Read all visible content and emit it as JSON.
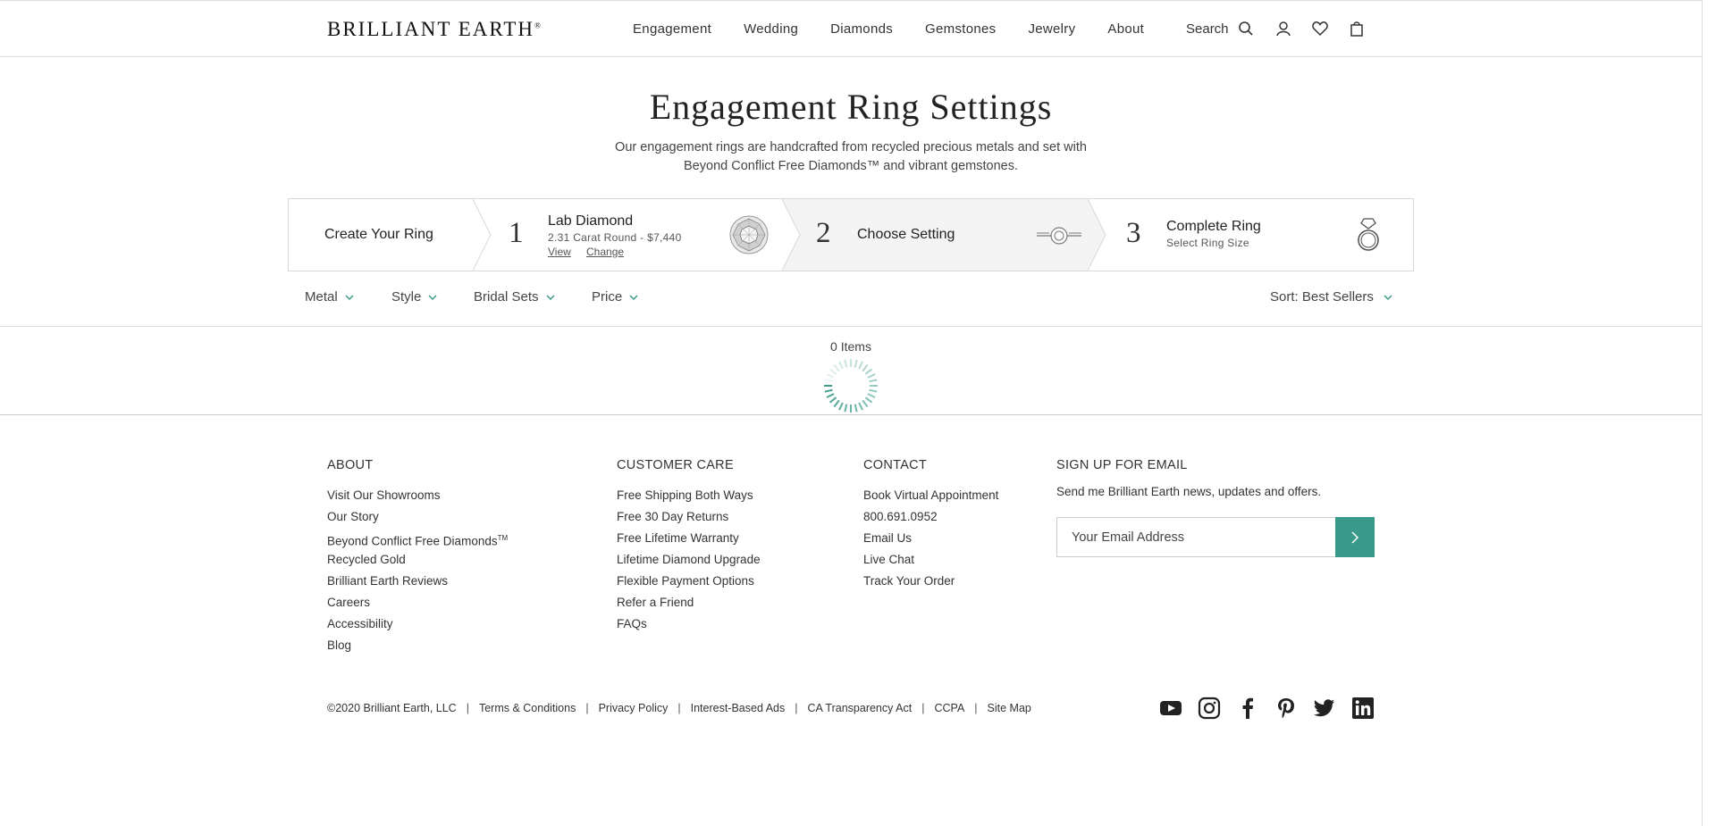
{
  "header": {
    "logo": "BRILLIANT EARTH",
    "logo_mark": "®",
    "nav": [
      "Engagement",
      "Wedding",
      "Diamonds",
      "Gemstones",
      "Jewelry",
      "About"
    ],
    "search_label": "Search"
  },
  "page": {
    "title": "Engagement Ring Settings",
    "subtitle_line1": "Our engagement rings are handcrafted from recycled precious metals and set with",
    "subtitle_line2": "Beyond Conflict Free Diamonds™ and vibrant gemstones."
  },
  "steps": {
    "start_label": "Create Your Ring",
    "step1": {
      "num": "1",
      "title": "Lab Diamond",
      "sub": "2.31 Carat Round - $7,440",
      "view": "View",
      "change": "Change"
    },
    "step2": {
      "num": "2",
      "title": "Choose Setting"
    },
    "step3": {
      "num": "3",
      "title": "Complete Ring",
      "sub": "Select Ring Size"
    }
  },
  "filters": {
    "metal": "Metal",
    "style": "Style",
    "bridal_sets": "Bridal Sets",
    "price": "Price",
    "sort": "Sort: Best Sellers"
  },
  "results": {
    "count": "0 Items"
  },
  "footer": {
    "about": {
      "heading": "ABOUT",
      "links": [
        "Visit Our Showrooms",
        "Our Story",
        "Beyond Conflict Free Diamonds",
        "Recycled Gold",
        "Brilliant Earth Reviews",
        "Careers",
        "Accessibility",
        "Blog"
      ],
      "tm": "TM"
    },
    "care": {
      "heading": "CUSTOMER CARE",
      "links": [
        "Free Shipping Both Ways",
        "Free 30 Day Returns",
        "Free Lifetime Warranty",
        "Lifetime Diamond Upgrade",
        "Flexible Payment Options",
        "Refer a Friend",
        "FAQs"
      ]
    },
    "contact": {
      "heading": "CONTACT",
      "links": [
        "Book Virtual Appointment",
        "800.691.0952",
        "Email Us",
        "Live Chat",
        "Track Your Order"
      ]
    },
    "email": {
      "heading": "SIGN UP FOR EMAIL",
      "text": "Send me Brilliant Earth news, updates and offers.",
      "placeholder": "Your Email Address"
    },
    "legal": [
      "©2020 Brilliant Earth, LLC",
      "Terms & Conditions",
      "Privacy Policy",
      "Interest-Based Ads",
      "CA Transparency Act",
      "CCPA",
      "Site Map"
    ],
    "social_icons": [
      "youtube-icon",
      "instagram-icon",
      "facebook-icon",
      "pinterest-icon",
      "twitter-icon",
      "linkedin-icon"
    ]
  },
  "colors": {
    "accent": "#3a9a89"
  }
}
